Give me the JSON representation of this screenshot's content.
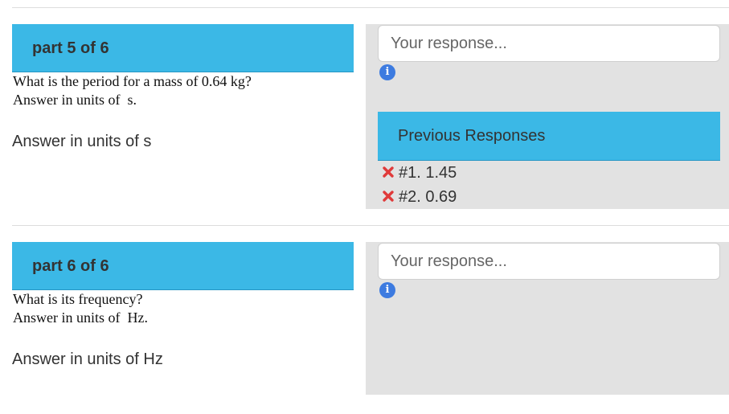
{
  "parts": [
    {
      "title": "part 5 of 6",
      "question_line1": "What is the period for a mass of 0.64 kg?",
      "question_line2": "Answer in units of  s.",
      "units_note": "Answer in units of s",
      "response_placeholder": "Your response...",
      "previous_responses": {
        "title": "Previous Responses",
        "items": [
          {
            "label": "#1. 1.45",
            "status": "incorrect"
          },
          {
            "label": "#2. 0.69",
            "status": "incorrect"
          }
        ]
      }
    },
    {
      "title": "part 6 of 6",
      "question_line1": "What is its frequency?",
      "question_line2": "Answer in units of  Hz.",
      "units_note": "Answer in units of Hz",
      "response_placeholder": "Your response..."
    }
  ],
  "icons": {
    "info": "info-icon",
    "incorrect": "x-icon"
  },
  "colors": {
    "header_blue": "#3bb8e6",
    "panel_gray": "#e2e2e2",
    "incorrect_red": "#e03a3a",
    "info_blue": "#3d7be0"
  }
}
